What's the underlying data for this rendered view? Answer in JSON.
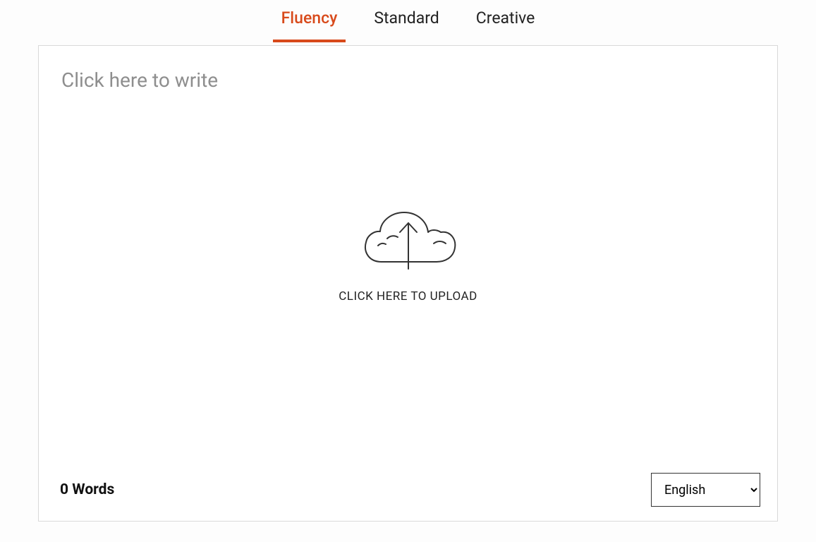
{
  "tabs": [
    {
      "label": "Fluency",
      "active": true
    },
    {
      "label": "Standard",
      "active": false
    },
    {
      "label": "Creative",
      "active": false
    }
  ],
  "editor": {
    "placeholder": "Click here to write"
  },
  "upload": {
    "label": "CLICK HERE TO UPLOAD",
    "icon_name": "cloud-upload-icon"
  },
  "footer": {
    "word_count_label": "0 Words"
  },
  "language": {
    "selected": "English"
  }
}
